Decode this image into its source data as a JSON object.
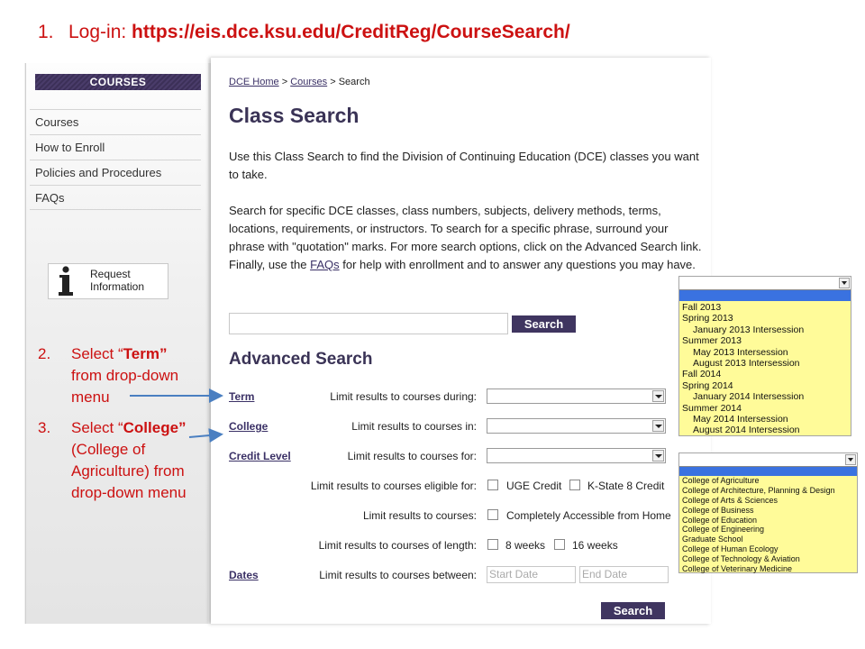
{
  "step1": {
    "number": "1.",
    "prefix": "Log-in: ",
    "url": "https://eis.dce.ksu.edu/CreditReg/CourseSearch/"
  },
  "sidebar": {
    "header": "COURSES",
    "items": [
      {
        "label": "Courses"
      },
      {
        "label": "How to Enroll"
      },
      {
        "label": "Policies and Procedures"
      },
      {
        "label": "FAQs"
      }
    ],
    "request_info": {
      "line1": "Request",
      "line2": "Information",
      "icon": "info-icon"
    }
  },
  "breadcrumb": {
    "home": "DCE Home",
    "sep": ">",
    "courses": "Courses",
    "current": "Search"
  },
  "page_title": "Class Search",
  "intro": "Use this Class Search to find the Division of Continuing Education (DCE) classes you want to take.",
  "instructions": {
    "before_link": "Search for specific DCE classes, class numbers, subjects, delivery methods, terms, locations, requirements, or instructors. To search for a specific phrase, surround your phrase with \"quotation\" marks. For more search options, click on the Advanced Search link. Finally, use the ",
    "link": "FAQs",
    "after_link": " for help with enrollment and to answer any questions you may have."
  },
  "search": {
    "value": "",
    "button": "Search"
  },
  "advanced": {
    "title": "Advanced Search",
    "term": {
      "name": "Term",
      "label": "Limit results to courses during:"
    },
    "college": {
      "name": "College",
      "label": "Limit results to courses in:"
    },
    "credit_level": {
      "name": "Credit Level",
      "label": "Limit results to courses for:"
    },
    "eligible": {
      "label": "Limit results to courses eligible for:",
      "opt1": "UGE Credit",
      "opt2": "K-State 8 Credit"
    },
    "accessible": {
      "label": "Limit results to courses:",
      "opt1": "Completely Accessible from Home"
    },
    "length": {
      "label": "Limit results to courses of length:",
      "opt1": "8 weeks",
      "opt2": "16 weeks"
    },
    "dates": {
      "name": "Dates",
      "label": "Limit results to courses between:",
      "start_placeholder": "Start Date",
      "end_placeholder": "End Date"
    },
    "button": "Search"
  },
  "annotations": {
    "step2": {
      "number": "2.",
      "pre": "Select “",
      "bold": "Term”",
      "line2": "from drop-down",
      "line3": "menu"
    },
    "step3": {
      "number": "3.",
      "pre": "Select “",
      "bold": "College”",
      "line2": "(College of",
      "line3": "Agriculture) from",
      "line4": "drop-down menu"
    }
  },
  "term_dropdown": [
    {
      "label": "Fall 2013",
      "indent": false
    },
    {
      "label": "Spring 2013",
      "indent": false
    },
    {
      "label": "January 2013 Intersession",
      "indent": true
    },
    {
      "label": "Summer 2013",
      "indent": false
    },
    {
      "label": "May 2013 Intersession",
      "indent": true
    },
    {
      "label": "August 2013 Intersession",
      "indent": true
    },
    {
      "label": "Fall 2014",
      "indent": false
    },
    {
      "label": "Spring 2014",
      "indent": false
    },
    {
      "label": "January 2014 Intersession",
      "indent": true
    },
    {
      "label": "Summer 2014",
      "indent": false
    },
    {
      "label": "May 2014 Intersession",
      "indent": true
    },
    {
      "label": "August 2014 Intersession",
      "indent": true
    }
  ],
  "college_dropdown": [
    "College of Agriculture",
    "College of Architecture, Planning & Design",
    "College of Arts & Sciences",
    "College of Business",
    "College of Education",
    "College of Engineering",
    "Graduate School",
    "College of Human Ecology",
    "College of Technology & Aviation",
    "College of Veterinary Medicine"
  ],
  "colors": {
    "accent": "#3f3560",
    "annotation": "#cc1111",
    "dropdown_bg": "#fffb99",
    "highlight": "#3a72e0",
    "arrow": "#4a7fc1"
  }
}
